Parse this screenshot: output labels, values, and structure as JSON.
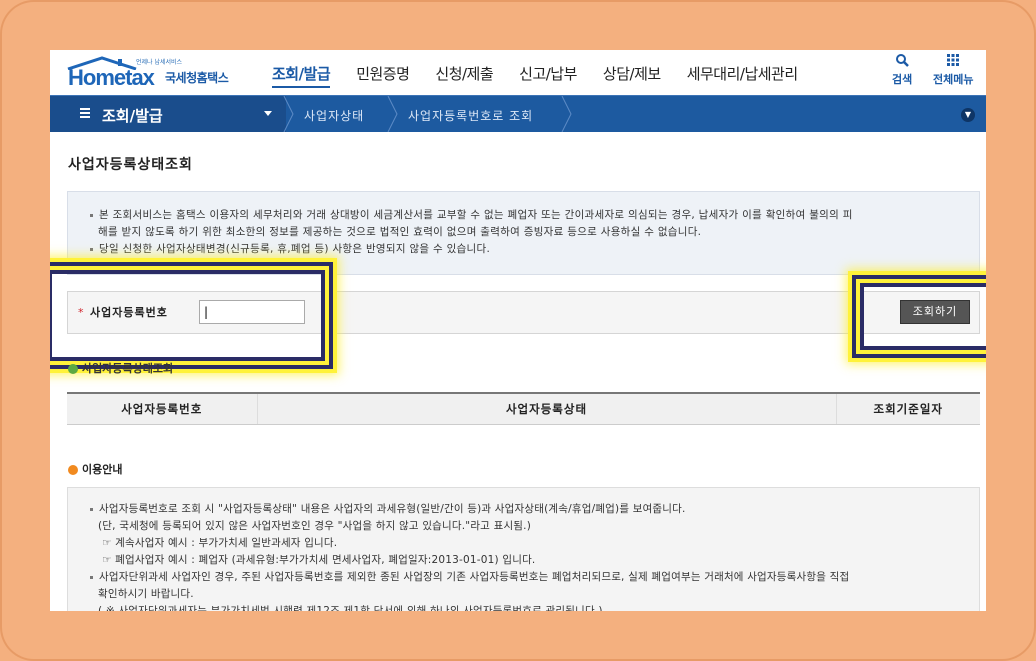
{
  "header": {
    "brand": "Hometax",
    "brand_tag": "언제나 납세서비스",
    "brand_name": "국세청홈택스",
    "nav": [
      "조회/발급",
      "민원증명",
      "신청/제출",
      "신고/납부",
      "상담/제보",
      "세무대리/납세관리"
    ],
    "active_nav": "조회/발급",
    "search_label": "검색",
    "menu_label": "전체메뉴"
  },
  "breadcrumb": {
    "home": "조회/발급",
    "segments": [
      "사업자상태",
      "사업자등록번호로 조회"
    ]
  },
  "page": {
    "title": "사업자등록상태조회",
    "notice": [
      "본 조회서비스는 홈택스 이용자의 세무처리와 거래 상대방이 세금계산서를 교부할 수 없는 폐업자 또는 간이과세자로 의심되는 경우, 납세자가 이를 확인하여 불의의 피",
      "해를 받지 않도록 하기 위한 최소한의 정보를 제공하는 것으로 법적인 효력이 없으며 출력하여 증빙자료 등으로 사용하실 수 없습니다.",
      "당일 신청한 사업자상태변경(신규등록, 휴,폐업 등) 사항은 반영되지 않을 수 있습니다."
    ],
    "search": {
      "label": "사업자등록번호",
      "value": "|",
      "button": "조회하기"
    },
    "result_title": "사업자등록상태조회",
    "table_headers": [
      "사업자등록번호",
      "사업자등록상태",
      "조회기준일자"
    ],
    "guide_title": "이용안내",
    "guide": [
      "사업자등록번호로 조회 시 \"사업자등록상태\" 내용은 사업자의 과세유형(일반/간이 등)과 사업자상태(계속/휴업/폐업)를 보여줍니다.",
      "(단, 국세청에 등록되어 있지 않은 사업자번호인 경우 \"사업을 하지 않고 있습니다.\"라고 표시됨.)",
      "☞ 계속사업자 예시 : 부가가치세 일반과세자 입니다.",
      "☞ 폐업사업자 예시 : 폐업자 (과세유형:부가가치세 면세사업자, 폐업일자:2013-01-01) 입니다.",
      "사업자단위과세 사업자인 경우, 주된 사업자등록번호를 제외한 종된 사업장의 기존 사업자등록번호는 폐업처리되므로, 실제 폐업여부는 거래처에 사업자등록사항을 직접",
      "확인하시기 바랍니다.",
      "( ※ 사업자단위과세자는 부가가치세법 시행령 제12조 제1항 단서에 의해 하나의 사업자등록번호로 관리됩니다.)"
    ]
  },
  "colors": {
    "nav_blue": "#1b5aa6",
    "crumb_bar": "#1d5aa0",
    "highlight_yellow": "#fff23a",
    "highlight_navy": "#2a2c66",
    "background": "#f4b07f"
  }
}
